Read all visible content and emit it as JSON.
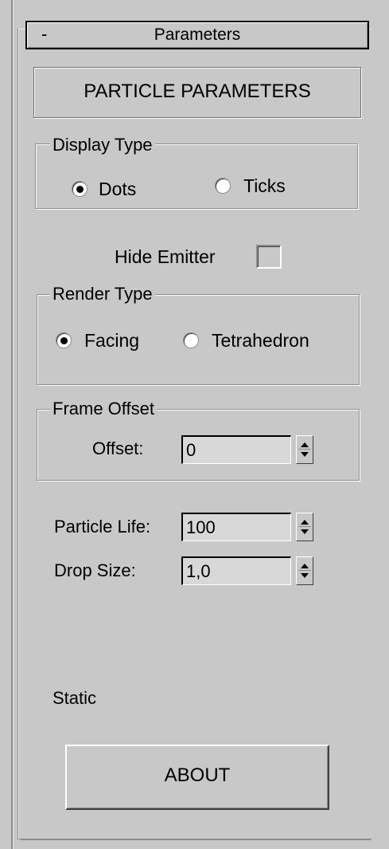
{
  "rollout": {
    "collapse_symbol": "-",
    "title": "Parameters"
  },
  "particle_parameters_button": "PARTICLE PARAMETERS",
  "display_type": {
    "label": "Display Type",
    "options": [
      {
        "label": "Dots",
        "checked": true
      },
      {
        "label": "Ticks",
        "checked": false
      }
    ]
  },
  "hide_emitter": {
    "label": "Hide Emitter",
    "checked": false
  },
  "render_type": {
    "label": "Render Type",
    "options": [
      {
        "label": "Facing",
        "checked": true
      },
      {
        "label": "Tetrahedron",
        "checked": false
      }
    ]
  },
  "frame_offset": {
    "label": "Frame Offset",
    "offset_label": "Offset:",
    "offset_value": "0"
  },
  "particle_life": {
    "label": "Particle Life:",
    "value": "100"
  },
  "drop_size": {
    "label": "Drop Size:",
    "value": "1,0"
  },
  "static_label": "Static",
  "about_button": "ABOUT"
}
